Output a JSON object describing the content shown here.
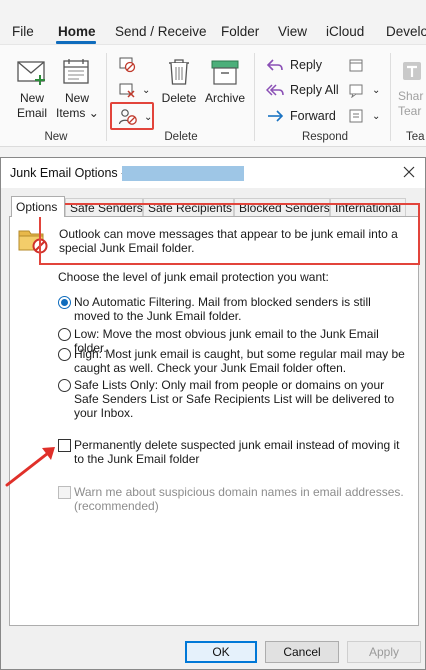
{
  "ribbon": {
    "tabs": [
      "File",
      "Home",
      "Send / Receive",
      "Folder",
      "View",
      "iCloud",
      "Develo"
    ],
    "active_tab": "Home",
    "new_group": {
      "label": "New",
      "new_email": [
        "New",
        "Email"
      ],
      "new_items": [
        "New",
        "Items"
      ]
    },
    "delete_group": {
      "label": "Delete",
      "delete": "Delete",
      "archive": "Archive"
    },
    "respond_group": {
      "label": "Respond",
      "reply": "Reply",
      "reply_all": "Reply All",
      "forward": "Forward"
    },
    "teams_group": {
      "label": "Tea",
      "share": [
        "Shar",
        "Tear"
      ]
    }
  },
  "dialog": {
    "title": "Junk Email Options -",
    "tabs": [
      "Options",
      "Safe Senders",
      "Safe Recipients",
      "Blocked Senders",
      "International"
    ],
    "active_tab": "Options",
    "info": "Outlook can move messages that appear to be junk email into a special Junk Email folder.",
    "protection_label": "Choose the level of junk email protection you want:",
    "options": [
      "No Automatic Filtering. Mail from blocked senders is still moved to the Junk Email folder.",
      "Low: Move the most obvious junk email to the Junk Email folder.",
      "High: Most junk email is caught, but some regular mail may be caught as well. Check your Junk Email folder often.",
      "Safe Lists Only: Only mail from people or domains on your Safe Senders List or Safe Recipients List will be delivered to your Inbox."
    ],
    "selected_option": 0,
    "permanent_delete": "Permanently delete suspected junk email instead of moving it to the Junk Email folder",
    "warn_suspicious": "Warn me about suspicious domain names in email addresses. (recommended)",
    "buttons": {
      "ok": "OK",
      "cancel": "Cancel",
      "apply": "Apply"
    }
  },
  "colors": {
    "accent": "#0f6cbd",
    "highlight": "#e2443b",
    "redaction": "#9ec6e6"
  }
}
